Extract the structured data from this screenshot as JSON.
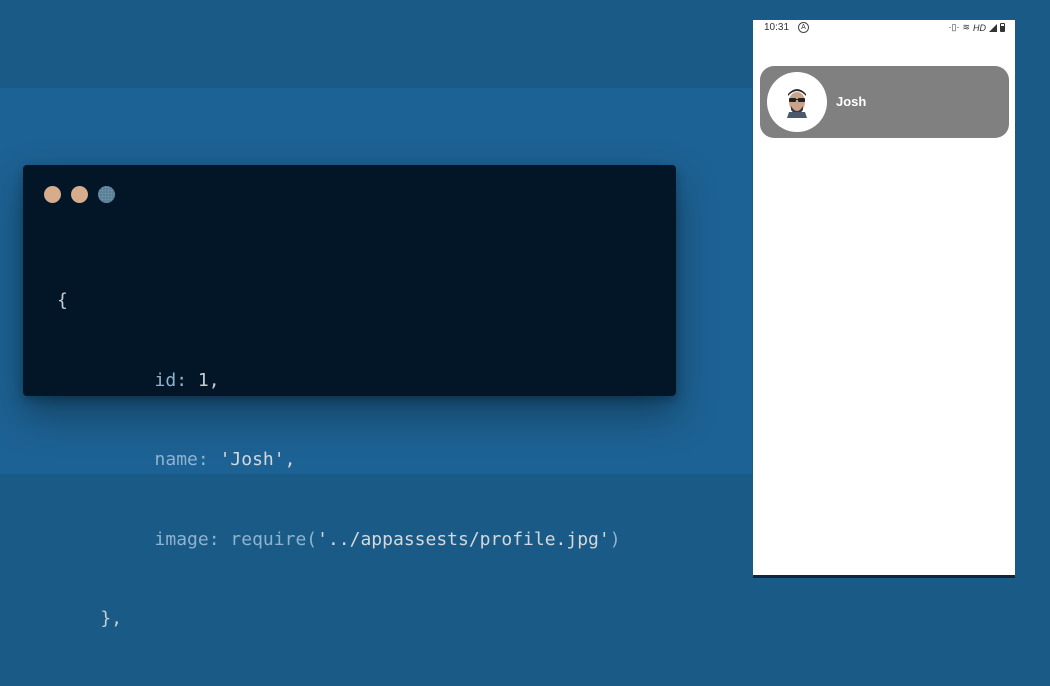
{
  "colors": {
    "background": "#1a5a86",
    "band": "#1d6294",
    "code_window_bg": "#021628",
    "dot_1": "#d6ac8c",
    "dot_2": "#d6ac8c",
    "dot_3": "#5a7f95",
    "card_bg": "#808080"
  },
  "code": {
    "lines": [
      "{",
      "id: 1,",
      "name: 'Josh',",
      "image: require('../appassests/profile.jpg')",
      "},"
    ],
    "tokens": {
      "open_brace": "{",
      "id_key": "id:",
      "id_val": "1,",
      "name_key": "name:",
      "name_val": "'Josh',",
      "image_key": "image:",
      "image_fn": "require(",
      "image_val": "'../appassests/profile.jpg'",
      "image_close": ")",
      "close": "},"
    }
  },
  "phone": {
    "status_bar": {
      "time": "10:31",
      "hd_label": "HD"
    },
    "card": {
      "name": "Josh",
      "avatar_icon": "profile-avatar-icon"
    }
  }
}
